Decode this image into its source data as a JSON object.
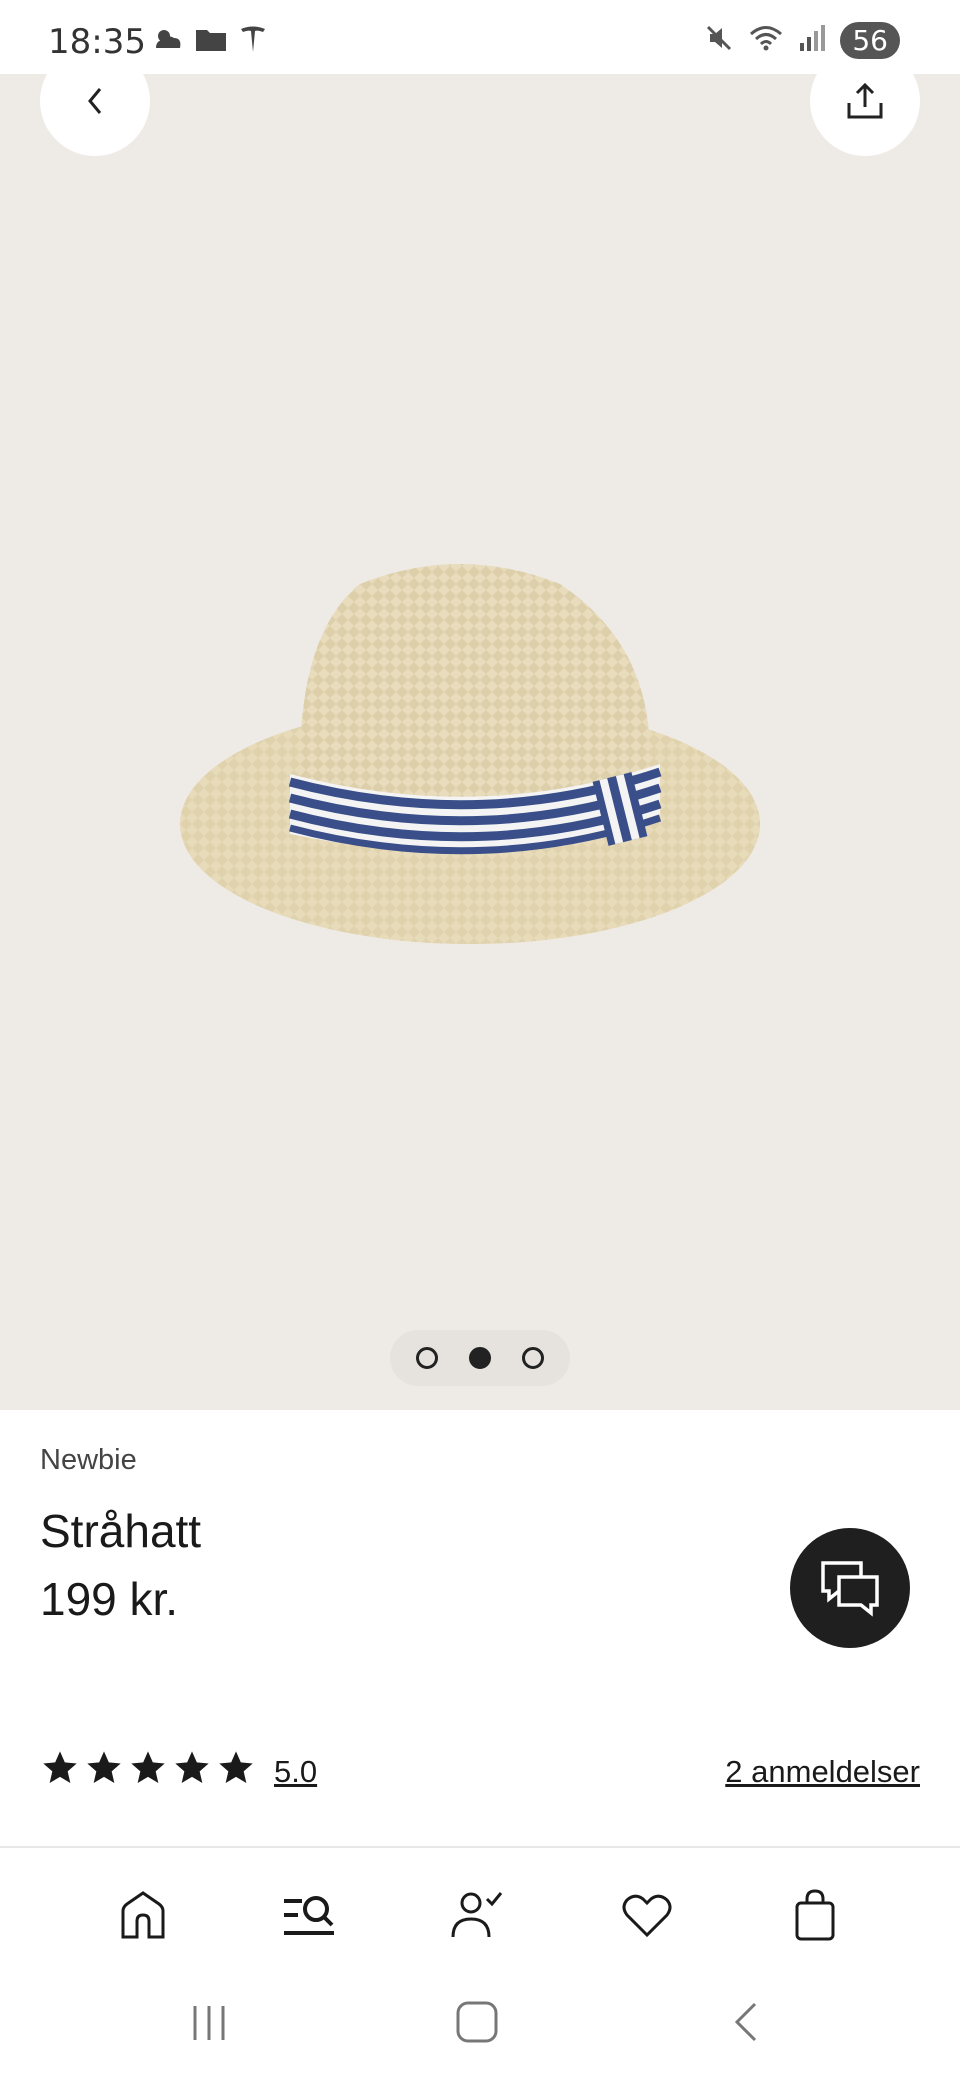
{
  "status_bar": {
    "time": "18:35",
    "battery": "56",
    "icons_left": [
      "weather-icon",
      "folder-icon",
      "tesla-icon"
    ],
    "icons_right": [
      "mute-icon",
      "wifi-icon",
      "signal-icon",
      "battery-icon"
    ]
  },
  "hero": {
    "image_alt": "Stråhatt",
    "carousel": {
      "total": 3,
      "active_index": 1
    }
  },
  "product": {
    "brand": "Newbie",
    "name": "Stråhatt",
    "price": "199 kr."
  },
  "rating": {
    "stars_filled": 5,
    "value": "5.0",
    "reviews_label": "2 anmeldelser"
  },
  "bottom_nav": {
    "items": [
      "home-icon",
      "search-icon",
      "account-icon",
      "favorites-icon",
      "bag-icon"
    ],
    "active": "search-icon"
  },
  "colors": {
    "hero_bg": "#eeebe6",
    "text": "#1a1a1a",
    "chat_button": "#1f1f1f"
  }
}
